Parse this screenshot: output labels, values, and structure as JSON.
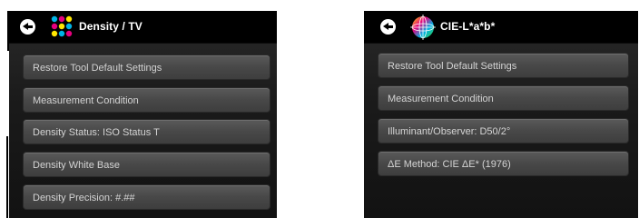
{
  "left_panel": {
    "title": "Density / TV",
    "items": [
      {
        "label": "Restore Tool Default Settings"
      },
      {
        "label": "Measurement Condition"
      },
      {
        "label": "Density Status: ISO Status T"
      },
      {
        "label": "Density White Base"
      },
      {
        "label": "Density Precision: #.##"
      }
    ]
  },
  "right_panel": {
    "title": "CIE-L*a*b*",
    "items": [
      {
        "label": "Restore Tool Default Settings"
      },
      {
        "label": "Measurement Condition"
      },
      {
        "label": "Illuminant/Observer: D50/2°"
      },
      {
        "label": "ΔE Method: CIE ΔE* (1976)"
      }
    ]
  },
  "colors": {
    "cyan": "#00b4e6",
    "magenta": "#e6007e",
    "yellow": "#ffe600",
    "black": "#222222"
  },
  "icons": {
    "back": "back-arrow-icon",
    "density": "density-dots-icon",
    "cie": "cie-lab-sphere-icon"
  }
}
